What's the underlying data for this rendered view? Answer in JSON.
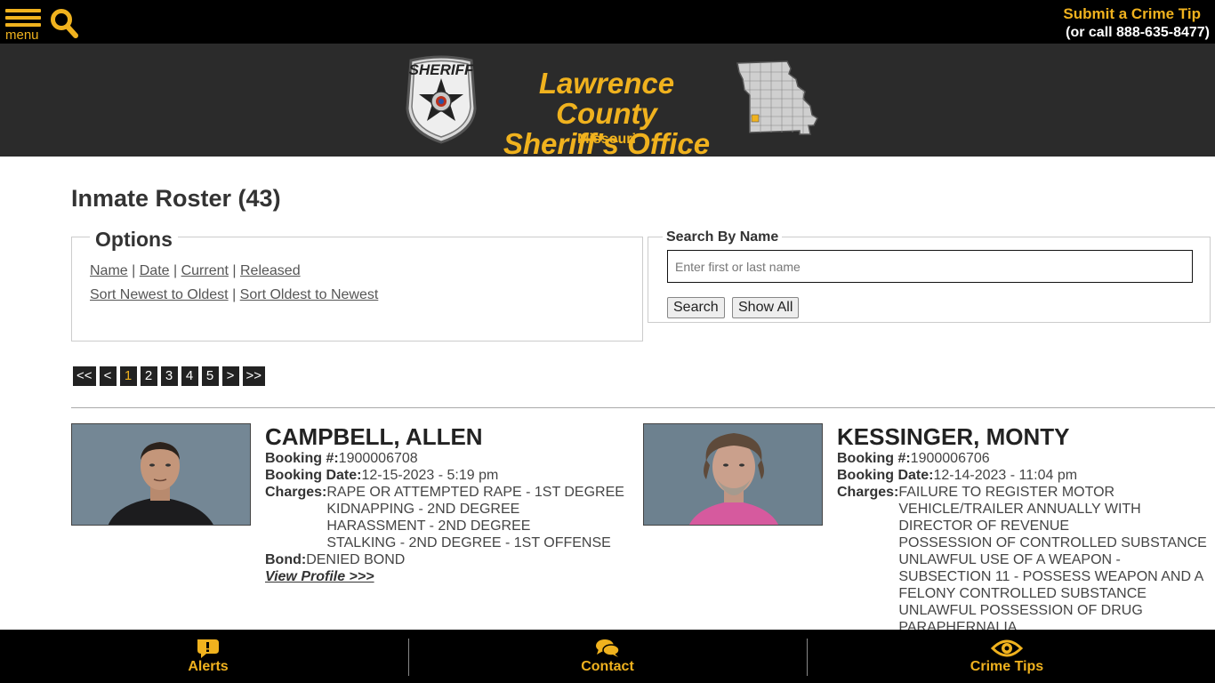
{
  "topbar": {
    "menu_label": "menu",
    "crime_tip_label": "Submit a Crime Tip",
    "phone_text": "(or call 888-635-8477)"
  },
  "header": {
    "org_line1": "Lawrence County",
    "org_line2": "Sheriff's Office",
    "state": "Missouri",
    "badge_text": "SHERIFF"
  },
  "page": {
    "title": "Inmate Roster (43)"
  },
  "options": {
    "legend": "Options",
    "sort_links": [
      "Name",
      "Date",
      "Current",
      "Released"
    ],
    "order_links": [
      "Sort Newest to Oldest",
      "Sort Oldest to Newest"
    ],
    "separator": " | "
  },
  "search": {
    "legend": "Search By Name",
    "placeholder": "Enter first or last name",
    "search_button": "Search",
    "show_all_button": "Show All"
  },
  "pagination": [
    "<<",
    "<",
    "1",
    "2",
    "3",
    "4",
    "5",
    ">",
    ">>"
  ],
  "pagination_active": "1",
  "inmates": [
    {
      "name": "CAMPBELL, ALLEN",
      "booking_no_label": "Booking #:",
      "booking_no": "1900006708",
      "booking_date_label": "Booking Date:",
      "booking_date": "12-15-2023 - 5:19 pm",
      "charges_label": "Charges:",
      "charges": [
        "RAPE OR ATTEMPTED RAPE - 1ST DEGREE",
        "KIDNAPPING - 2ND DEGREE",
        "HARASSMENT - 2ND DEGREE",
        "STALKING - 2ND DEGREE - 1ST OFFENSE"
      ],
      "bond_label": "Bond:",
      "bond": "DENIED BOND",
      "profile_link": "View Profile >>>"
    },
    {
      "name": "KESSINGER, MONTY",
      "booking_no_label": "Booking #:",
      "booking_no": "1900006706",
      "booking_date_label": "Booking Date:",
      "booking_date": "12-14-2023 - 11:04 pm",
      "charges_label": "Charges:",
      "charges": [
        "FAILURE TO REGISTER MOTOR VEHICLE/TRAILER ANNUALLY WITH DIRECTOR OF REVENUE",
        "POSSESSION OF CONTROLLED SUBSTANCE",
        "UNLAWFUL USE OF A WEAPON - SUBSECTION 11 - POSSESS WEAPON AND A FELONY CONTROLLED SUBSTANCE",
        "UNLAWFUL POSSESSION OF DRUG PARAPHERNALIA"
      ]
    }
  ],
  "bottombar": {
    "alerts_label": "Alerts",
    "contact_label": "Contact",
    "tips_label": "Crime Tips"
  },
  "colors": {
    "accent": "#f0b21e",
    "topbar_bg": "#000000",
    "header_bg": "#2b2b2b"
  }
}
